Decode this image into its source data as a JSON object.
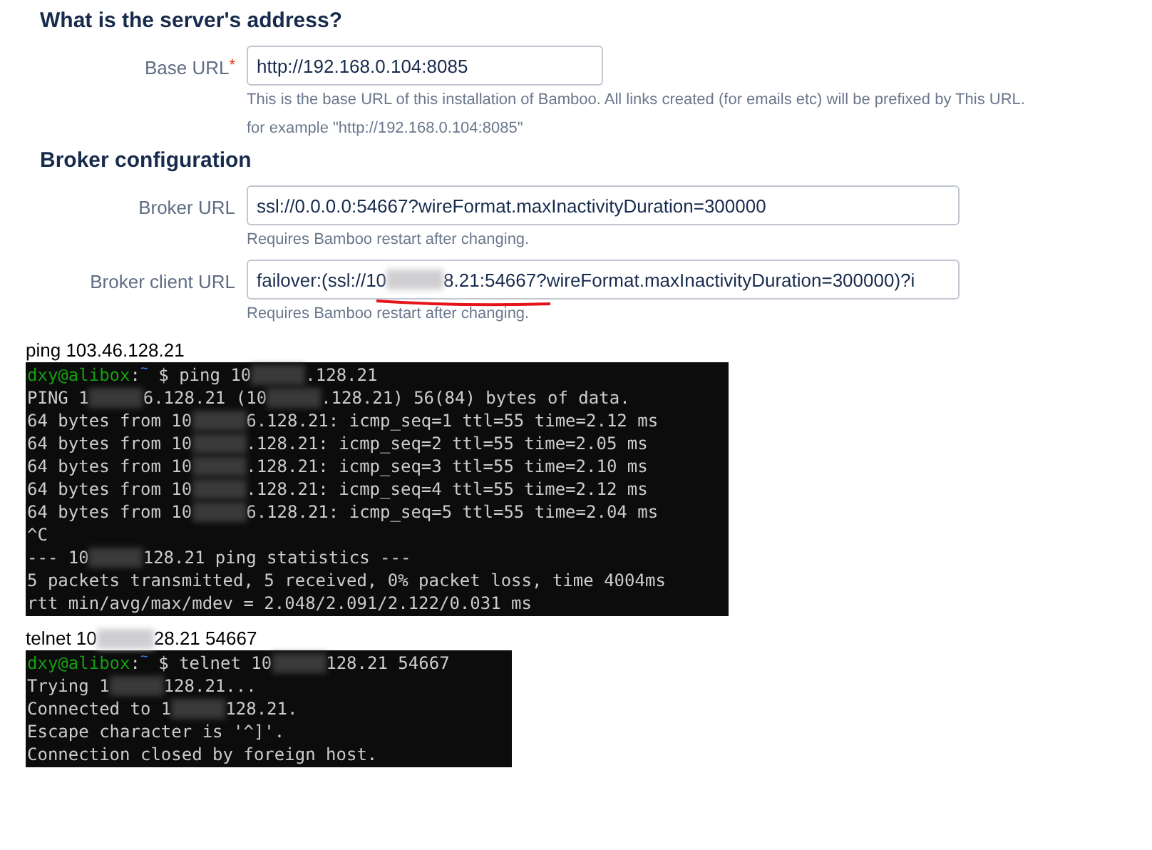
{
  "server_section": {
    "heading": "What is the server's address?",
    "fields": [
      {
        "label": "Base URL",
        "required_mark": "*",
        "value_parts": [
          "http://192.168.0.104:8085"
        ],
        "kind": "short",
        "help": [
          "This is the base URL of this installation of Bamboo. All links created (for emails etc) will be prefixed by This URL.",
          "for example \"http://192.168.0.104:8085\""
        ]
      }
    ]
  },
  "broker_section": {
    "heading": "Broker configuration",
    "fields": [
      {
        "label": "Broker URL",
        "value_parts": [
          "ssl://0.0.0.0:54667?wireFormat.maxInactivityDuration=300000"
        ],
        "kind": "long",
        "help": [
          "Requires Bamboo restart after changing."
        ]
      },
      {
        "label": "Broker client URL",
        "value_parts": [
          "failover:(ssl://10",
          "8.21:54667?wireFormat.maxInactivityDuration=300000)?i"
        ],
        "kind": "long",
        "help": [
          "Requires Bamboo restart after changing."
        ],
        "underlined": true
      }
    ]
  },
  "terminals": [
    {
      "caption_parts": [
        "ping 103.46.128.21"
      ],
      "lines": [
        {
          "prompt": "dxy@alibox",
          "separator": ":",
          "path": "~",
          "parts": [
            " $ ping 10",
            ".128.21"
          ]
        },
        {
          "parts": [
            "PING 1",
            "6.128.21 (10",
            ".128.21) 56(84) bytes of data."
          ]
        },
        {
          "parts": [
            "64 bytes from 10",
            "6.128.21: icmp_seq=1 ttl=55 time=2.12 ms"
          ]
        },
        {
          "parts": [
            "64 bytes from 10",
            ".128.21: icmp_seq=2 ttl=55 time=2.05 ms"
          ]
        },
        {
          "parts": [
            "64 bytes from 10",
            ".128.21: icmp_seq=3 ttl=55 time=2.10 ms"
          ]
        },
        {
          "parts": [
            "64 bytes from 10",
            ".128.21: icmp_seq=4 ttl=55 time=2.12 ms"
          ]
        },
        {
          "parts": [
            "64 bytes from 10",
            "6.128.21: icmp_seq=5 ttl=55 time=2.04 ms"
          ]
        },
        {
          "parts": [
            "^C"
          ]
        },
        {
          "parts": [
            "--- 10",
            "128.21 ping statistics ---"
          ]
        },
        {
          "parts": [
            "5 packets transmitted, 5 received, 0% packet loss, time 4004ms"
          ]
        },
        {
          "parts": [
            "rtt min/avg/max/mdev = 2.048/2.091/2.122/0.031 ms"
          ]
        }
      ]
    },
    {
      "caption_parts": [
        "telnet 10",
        "28.21 54667"
      ],
      "lines": [
        {
          "prompt": "dxy@alibox",
          "separator": ":",
          "path": "~",
          "parts": [
            " $ telnet 10",
            "128.21 54667"
          ]
        },
        {
          "parts": [
            "Trying 1",
            "128.21..."
          ]
        },
        {
          "parts": [
            "Connected to 1",
            "128.21."
          ]
        },
        {
          "parts": [
            "Escape character is '^]'."
          ]
        },
        {
          "parts": [
            "Connection closed by foreign host."
          ]
        }
      ]
    }
  ]
}
